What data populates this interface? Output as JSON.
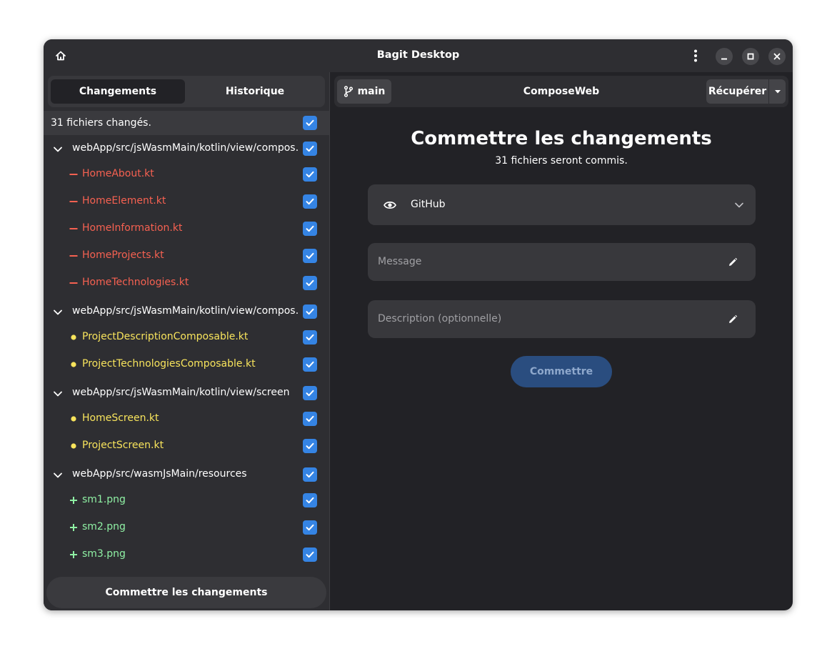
{
  "window": {
    "title": "Bagit Desktop"
  },
  "tabs": [
    {
      "label": "Changements",
      "active": true
    },
    {
      "label": "Historique",
      "active": false
    }
  ],
  "summary": {
    "text": "31 fichiers changés.",
    "checked": true
  },
  "file_groups": [
    {
      "path": "webApp/src/jsWasmMain/kotlin/view/compos…",
      "expanded": true,
      "files": [
        {
          "name": "HomeAbout.kt",
          "status": "deleted"
        },
        {
          "name": "HomeElement.kt",
          "status": "deleted"
        },
        {
          "name": "HomeInformation.kt",
          "status": "deleted"
        },
        {
          "name": "HomeProjects.kt",
          "status": "deleted"
        },
        {
          "name": "HomeTechnologies.kt",
          "status": "deleted"
        }
      ]
    },
    {
      "path": "webApp/src/jsWasmMain/kotlin/view/compos…",
      "expanded": true,
      "files": [
        {
          "name": "ProjectDescriptionComposable.kt",
          "status": "modified"
        },
        {
          "name": "ProjectTechnologiesComposable.kt",
          "status": "modified"
        }
      ]
    },
    {
      "path": "webApp/src/jsWasmMain/kotlin/view/screen",
      "expanded": true,
      "files": [
        {
          "name": "HomeScreen.kt",
          "status": "modified"
        },
        {
          "name": "ProjectScreen.kt",
          "status": "modified"
        }
      ]
    },
    {
      "path": "webApp/src/wasmJsMain/resources",
      "expanded": true,
      "files": [
        {
          "name": "sm1.png",
          "status": "added"
        },
        {
          "name": "sm2.png",
          "status": "added"
        },
        {
          "name": "sm3.png",
          "status": "added"
        }
      ]
    }
  ],
  "sidebar_commit_label": "Commettre les changements",
  "toolbar": {
    "branch": "main",
    "repo": "ComposeWeb",
    "fetch_label": "Récupérer"
  },
  "main": {
    "heading": "Commettre les changements",
    "subheading": "31 fichiers seront commis.",
    "provider": {
      "label": "GitHub",
      "icon": "eye-icon"
    },
    "message_placeholder": "Message",
    "description_placeholder": "Description (optionnelle)",
    "commit_label": "Commettre"
  },
  "colors": {
    "deleted": "#f66151",
    "modified": "#f8e45c",
    "added": "#8ff0a4",
    "accent": "#3584e4",
    "window_bg": "#222226",
    "sidebar_bg": "#2e2e32"
  }
}
